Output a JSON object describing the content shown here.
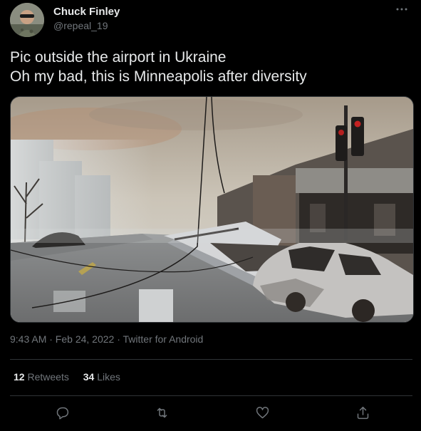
{
  "tweet": {
    "display_name": "Chuck Finley",
    "handle": "@repeal_19",
    "text_lines": [
      "Pic outside the airport in Ukraine",
      "Oh my bad, this is Minneapolis after diversity"
    ],
    "timestamp": "9:43 AM · Feb 24, 2022 · Twitter for Android",
    "retweets_count": "12",
    "retweets_label": "Retweets",
    "likes_count": "34",
    "likes_label": "Likes"
  },
  "icons": {
    "more": "more-dots-icon",
    "reply": "reply-icon",
    "retweet": "retweet-icon",
    "like": "heart-icon",
    "share": "share-icon"
  },
  "colors": {
    "background": "#000000",
    "text_primary": "#e7e9ea",
    "text_secondary": "#71767b",
    "divider": "#2f3336"
  }
}
